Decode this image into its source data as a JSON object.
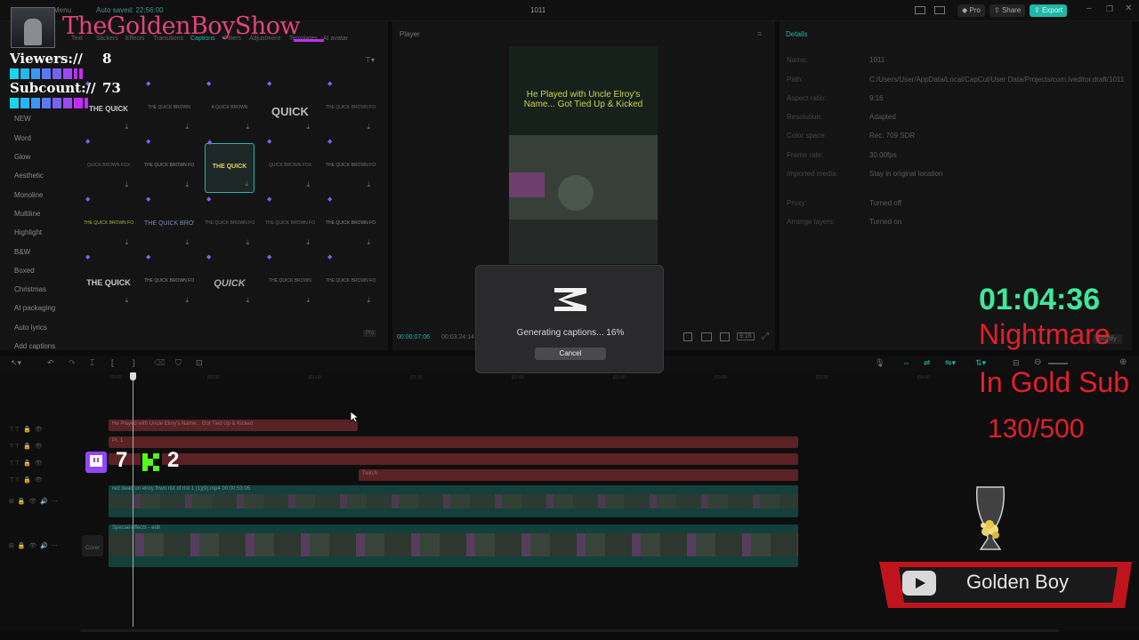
{
  "titlebar": {
    "menu": "Menu",
    "autosave": "Auto saved: 22:56:00",
    "project_title": "1011",
    "pro": "Pro",
    "share": "Share",
    "export": "Export"
  },
  "left_panel": {
    "tabs": [
      "Text",
      "Stickers",
      "Effects",
      "Transitions",
      "Captions",
      "Filters",
      "Adjustment",
      "Templates",
      "AI avatar"
    ],
    "categories": [
      "NEW",
      "Word",
      "Glow",
      "Aesthetic",
      "Monoline",
      "Multiline",
      "Highlight",
      "B&W",
      "Boxed",
      "Christmas",
      "AI packaging",
      "Auto lyrics",
      "Add captions"
    ],
    "tiles": [
      [
        "THE QUICK",
        "THE QUICK BROWN",
        "A QUICK BROWN",
        "QUICK",
        "THE QUICK BROWN FOX JUMPS"
      ],
      [
        "QUICK BROWN FOX",
        "THE QUICK BROWN FOX",
        "THE QUICK",
        "QUICK BROWN FOX",
        "THE QUICK BROWN FOX"
      ],
      [
        "THE QUICK BROWN FOX",
        "THE QUICK BROWN FOX",
        "THE QUICK BROWN FOX",
        "THE QUICK BROWN FOX",
        "THE QUICK BROWN FOX"
      ],
      [
        "THE QUICK",
        "THE QUICK BROWN FOX",
        "QUICK",
        "THE QUICK BROWN",
        "THE QUICK BROWN FOX"
      ]
    ],
    "pro_badge": "Pro"
  },
  "player": {
    "title": "Player",
    "caption_text": "He Played with Uncle Elroy's Name... Got Tied Up & Kicked",
    "time_current": "00:00:07:06",
    "time_total": "00:03:24:14",
    "ratio_label": "9:16"
  },
  "details": {
    "title": "Details",
    "rows": [
      {
        "k": "Name:",
        "v": "1011"
      },
      {
        "k": "Path:",
        "v": "C:/Users/User/AppData/Local/CapCut/User Data/Projects/com.lveditor.draft/1011"
      },
      {
        "k": "Aspect ratio:",
        "v": "9:16"
      },
      {
        "k": "Resolution:",
        "v": "Adapted"
      },
      {
        "k": "Color space:",
        "v": "Rec. 709 SDR"
      },
      {
        "k": "Frame rate:",
        "v": "30.00fps"
      },
      {
        "k": "Imported media:",
        "v": "Stay in original location"
      },
      {
        "k": "Proxy:",
        "v": "Turned off"
      },
      {
        "k": "Arrange layers:",
        "v": "Turned on"
      }
    ],
    "modify": "Modify"
  },
  "timeline": {
    "ruler": [
      "00:00",
      "|00:30",
      "|01:00",
      "|01:30",
      "|02:00",
      "|02:30",
      "|03:00",
      "|03:30",
      "|04:00"
    ],
    "text_track_1": "He Played with Uncle Elroy's Name... Got Tied Up & Kicked",
    "text_track_2": "Pt. 1",
    "text_track_4": "Twitch",
    "video_track_label": "red dead un elroy thwn rlst of rlst 1 (1)(9).mp4  00:00:53:05",
    "video_track_short": "red dead un elroy thwn rlst of",
    "effects_label": "Special effects - edit",
    "cover": "Cover"
  },
  "modal": {
    "status": "Generating captions... 16%",
    "progress_percent": 16,
    "cancel": "Cancel"
  },
  "overlay": {
    "channel_title": "TheGoldenBoyShow",
    "viewers_label": "Viewers://",
    "viewers_count": "8",
    "subcount_label": "Subcount://",
    "subcount_value": "73",
    "twitch_count": "7",
    "kick_count": "2",
    "timer": "01:04:36",
    "nightmare": "Nightmare",
    "gold_sub": "In Gold Sub",
    "sub_goal": "130/500",
    "youtube_name": "Golden Boy"
  },
  "colors": {
    "accent_teal": "#1fb7a6",
    "timer_green": "#3ee89a",
    "overlay_red": "#e41f2a",
    "title_pink": "#e0457a",
    "text_track": "#5a2224",
    "video_track": "#14403c"
  }
}
